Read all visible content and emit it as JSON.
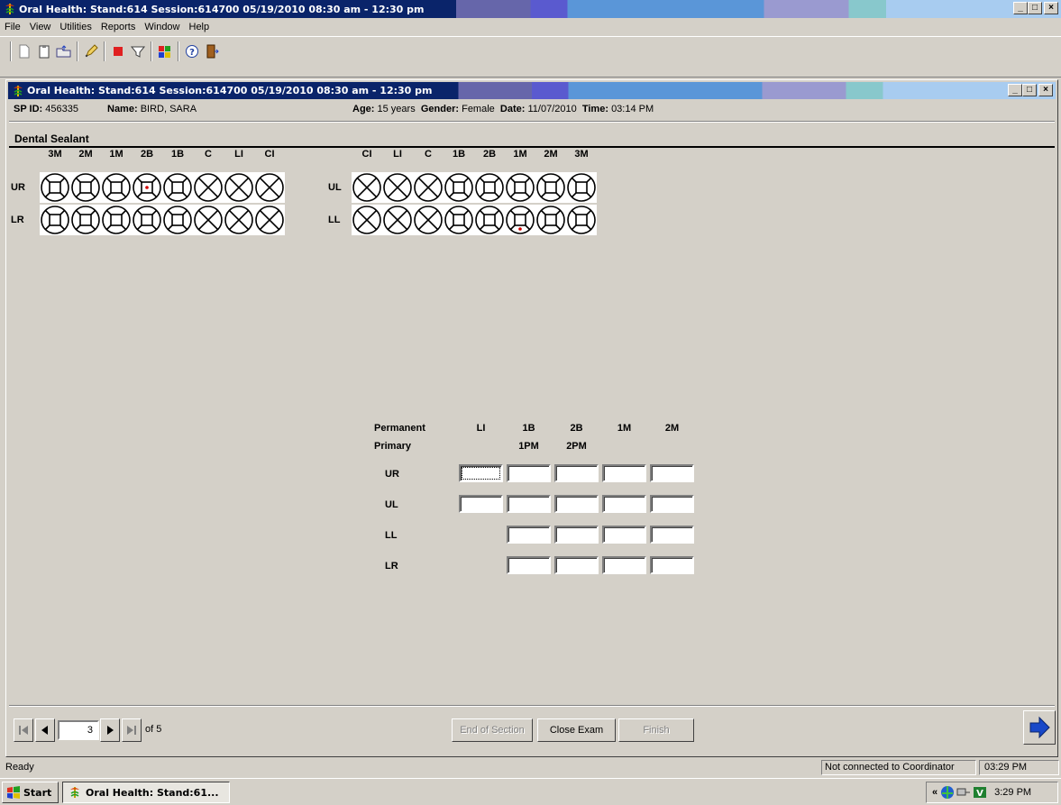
{
  "app": {
    "title": "Oral Health: Stand:614 Session:614700 05/19/2010 08:30 am - 12:30 pm",
    "window_buttons": {
      "minimize": "_",
      "maximize": "□",
      "close": "×"
    }
  },
  "menu": {
    "items": [
      "File",
      "View",
      "Utilities",
      "Reports",
      "Window",
      "Help"
    ]
  },
  "toolbar": {
    "buttons": [
      "new-document-icon",
      "clipboard-icon",
      "open-folder-icon",
      "edit-pencil-icon",
      "stop-icon",
      "filter-icon",
      "color-palette-icon",
      "help-icon",
      "exit-door-icon"
    ]
  },
  "child_window": {
    "title": "Oral Health: Stand:614 Session:614700 05/19/2010 08:30 am - 12:30 pm"
  },
  "info": {
    "sp_id_label": "SP ID:",
    "sp_id": "456335",
    "name_label": "Name:",
    "name": "BIRD, SARA",
    "age_label": "Age:",
    "age": "15 years",
    "gender_label": "Gender:",
    "gender": "Female",
    "date_label": "Date:",
    "date": "11/07/2010",
    "time_label": "Time:",
    "time": "03:14 PM"
  },
  "section": {
    "title": "Dental Sealant"
  },
  "chart": {
    "right_headers": [
      "3M",
      "2M",
      "1M",
      "2B",
      "1B",
      "C",
      "LI",
      "CI"
    ],
    "left_headers": [
      "CI",
      "LI",
      "C",
      "1B",
      "2B",
      "1M",
      "2M",
      "3M"
    ],
    "rows": [
      {
        "label_right": "UR",
        "label_left": "UL",
        "right_teeth": [
          "square",
          "square",
          "square",
          "square-dot-center",
          "square",
          "x",
          "x",
          "x"
        ],
        "left_teeth": [
          "x",
          "x",
          "x",
          "square",
          "square",
          "square",
          "square",
          "square"
        ]
      },
      {
        "label_right": "LR",
        "label_left": "LL",
        "right_teeth": [
          "square",
          "square",
          "square",
          "square",
          "square",
          "x",
          "x",
          "x"
        ],
        "left_teeth": [
          "x",
          "x",
          "x",
          "square",
          "square",
          "square-dot-bottom",
          "square",
          "square"
        ]
      }
    ],
    "colors": {
      "marker": "#d00000"
    }
  },
  "grid": {
    "header_permanent": "Permanent",
    "header_primary": "Primary",
    "columns_permanent": [
      "LI",
      "1B",
      "2B",
      "1M",
      "2M"
    ],
    "columns_primary": [
      "",
      "1PM",
      "2PM",
      "",
      ""
    ],
    "rows": [
      {
        "label": "UR",
        "inputs": [
          "",
          "",
          "",
          "",
          ""
        ]
      },
      {
        "label": "UL",
        "inputs": [
          "",
          "",
          "",
          "",
          ""
        ]
      },
      {
        "label": "LL",
        "inputs": [
          "",
          "",
          "",
          ""
        ]
      },
      {
        "label": "LR",
        "inputs": [
          "",
          "",
          "",
          ""
        ]
      }
    ]
  },
  "nav": {
    "page": "3",
    "of_label": "of 5",
    "end_of_section": "End of Section",
    "close_exam": "Close Exam",
    "finish": "Finish"
  },
  "status": {
    "ready": "Ready",
    "connection": "Not connected to Coordinator",
    "time": "03:29 PM"
  },
  "taskbar": {
    "start": "Start",
    "task": "Oral Health: Stand:61...",
    "tray_time": "3:29 PM",
    "tray_chevron": "«"
  }
}
